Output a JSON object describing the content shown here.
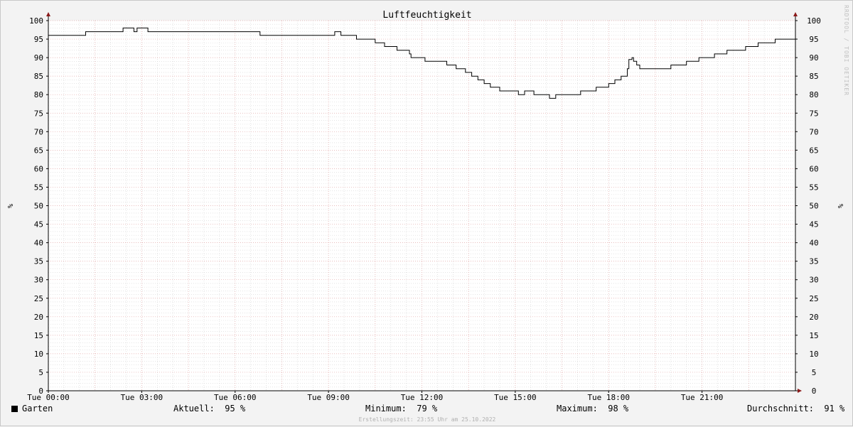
{
  "chart_data": {
    "type": "line",
    "title": "Luftfeuchtigkeit",
    "ylabel_left": "%",
    "ylabel_right": "%",
    "ylim": [
      0,
      100
    ],
    "y_ticks": [
      0,
      5,
      10,
      15,
      20,
      25,
      30,
      35,
      40,
      45,
      50,
      55,
      60,
      65,
      70,
      75,
      80,
      85,
      90,
      95,
      100
    ],
    "xlim": [
      0,
      24
    ],
    "x_ticks": [
      {
        "x": 0,
        "label": "Tue 00:00"
      },
      {
        "x": 3,
        "label": "Tue 03:00"
      },
      {
        "x": 6,
        "label": "Tue 06:00"
      },
      {
        "x": 9,
        "label": "Tue 09:00"
      },
      {
        "x": 12,
        "label": "Tue 12:00"
      },
      {
        "x": 15,
        "label": "Tue 15:00"
      },
      {
        "x": 18,
        "label": "Tue 18:00"
      },
      {
        "x": 21,
        "label": "Tue 21:00"
      }
    ],
    "grid": true,
    "series": [
      {
        "name": "Garten",
        "color": "#000000",
        "step": true,
        "points": [
          [
            0,
            96
          ],
          [
            1.2,
            97
          ],
          [
            2.4,
            98
          ],
          [
            2.75,
            97
          ],
          [
            2.85,
            98
          ],
          [
            3.2,
            97
          ],
          [
            6.8,
            96
          ],
          [
            9.2,
            97
          ],
          [
            9.4,
            96
          ],
          [
            9.9,
            95
          ],
          [
            10.5,
            94
          ],
          [
            10.8,
            93
          ],
          [
            11.2,
            92
          ],
          [
            11.6,
            91
          ],
          [
            11.65,
            90
          ],
          [
            12.1,
            89
          ],
          [
            12.8,
            88
          ],
          [
            13.1,
            87
          ],
          [
            13.4,
            86
          ],
          [
            13.6,
            85
          ],
          [
            13.8,
            84
          ],
          [
            14.0,
            83
          ],
          [
            14.2,
            82
          ],
          [
            14.5,
            81
          ],
          [
            15.1,
            80
          ],
          [
            15.3,
            81
          ],
          [
            15.6,
            80
          ],
          [
            16.1,
            79
          ],
          [
            16.3,
            80
          ],
          [
            17.1,
            81
          ],
          [
            17.6,
            82
          ],
          [
            18.0,
            83
          ],
          [
            18.2,
            84
          ],
          [
            18.4,
            85
          ],
          [
            18.6,
            87
          ],
          [
            18.65,
            89.5
          ],
          [
            18.75,
            90
          ],
          [
            18.8,
            89
          ],
          [
            18.9,
            88
          ],
          [
            19.0,
            87
          ],
          [
            20.0,
            88
          ],
          [
            20.5,
            89
          ],
          [
            20.9,
            90
          ],
          [
            21.4,
            91
          ],
          [
            21.8,
            92
          ],
          [
            22.4,
            93
          ],
          [
            22.8,
            94
          ],
          [
            23.35,
            95
          ],
          [
            24,
            95
          ]
        ]
      }
    ],
    "stats": {
      "aktuell_label": "Aktuell:",
      "aktuell_value": "95 %",
      "minimum_label": "Minimum:",
      "minimum_value": "79 %",
      "maximum_label": "Maximum:",
      "maximum_value": "98 %",
      "durchschnitt_label": "Durchschnitt:",
      "durchschnitt_value": "91 %"
    }
  },
  "footer": "Erstellungszeit: 23:55 Uhr am 25.10.2022",
  "watermark": "RRDTOOL / TOBI OETIKER"
}
